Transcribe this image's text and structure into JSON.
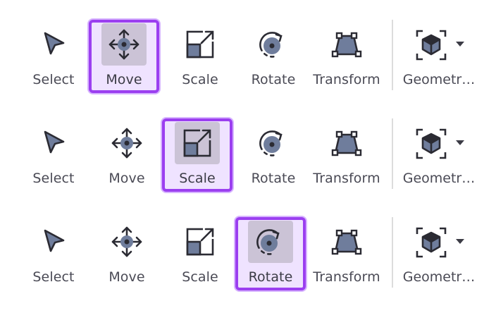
{
  "accent_color": "#9b3ff0",
  "toolbars": [
    {
      "active": "move",
      "tools": {
        "select": "Select",
        "move": "Move",
        "scale": "Scale",
        "rotate": "Rotate",
        "transform": "Transform",
        "geometry": "Geometr…"
      }
    },
    {
      "active": "scale",
      "tools": {
        "select": "Select",
        "move": "Move",
        "scale": "Scale",
        "rotate": "Rotate",
        "transform": "Transform",
        "geometry": "Geometr…"
      }
    },
    {
      "active": "rotate",
      "tools": {
        "select": "Select",
        "move": "Move",
        "scale": "Scale",
        "rotate": "Rotate",
        "transform": "Transform",
        "geometry": "Geometr…"
      }
    }
  ],
  "icons": [
    "select-arrow-icon",
    "move-arrows-icon",
    "scale-icon",
    "rotate-icon",
    "transform-icon",
    "geometry-cube-icon",
    "dropdown-caret-icon"
  ]
}
